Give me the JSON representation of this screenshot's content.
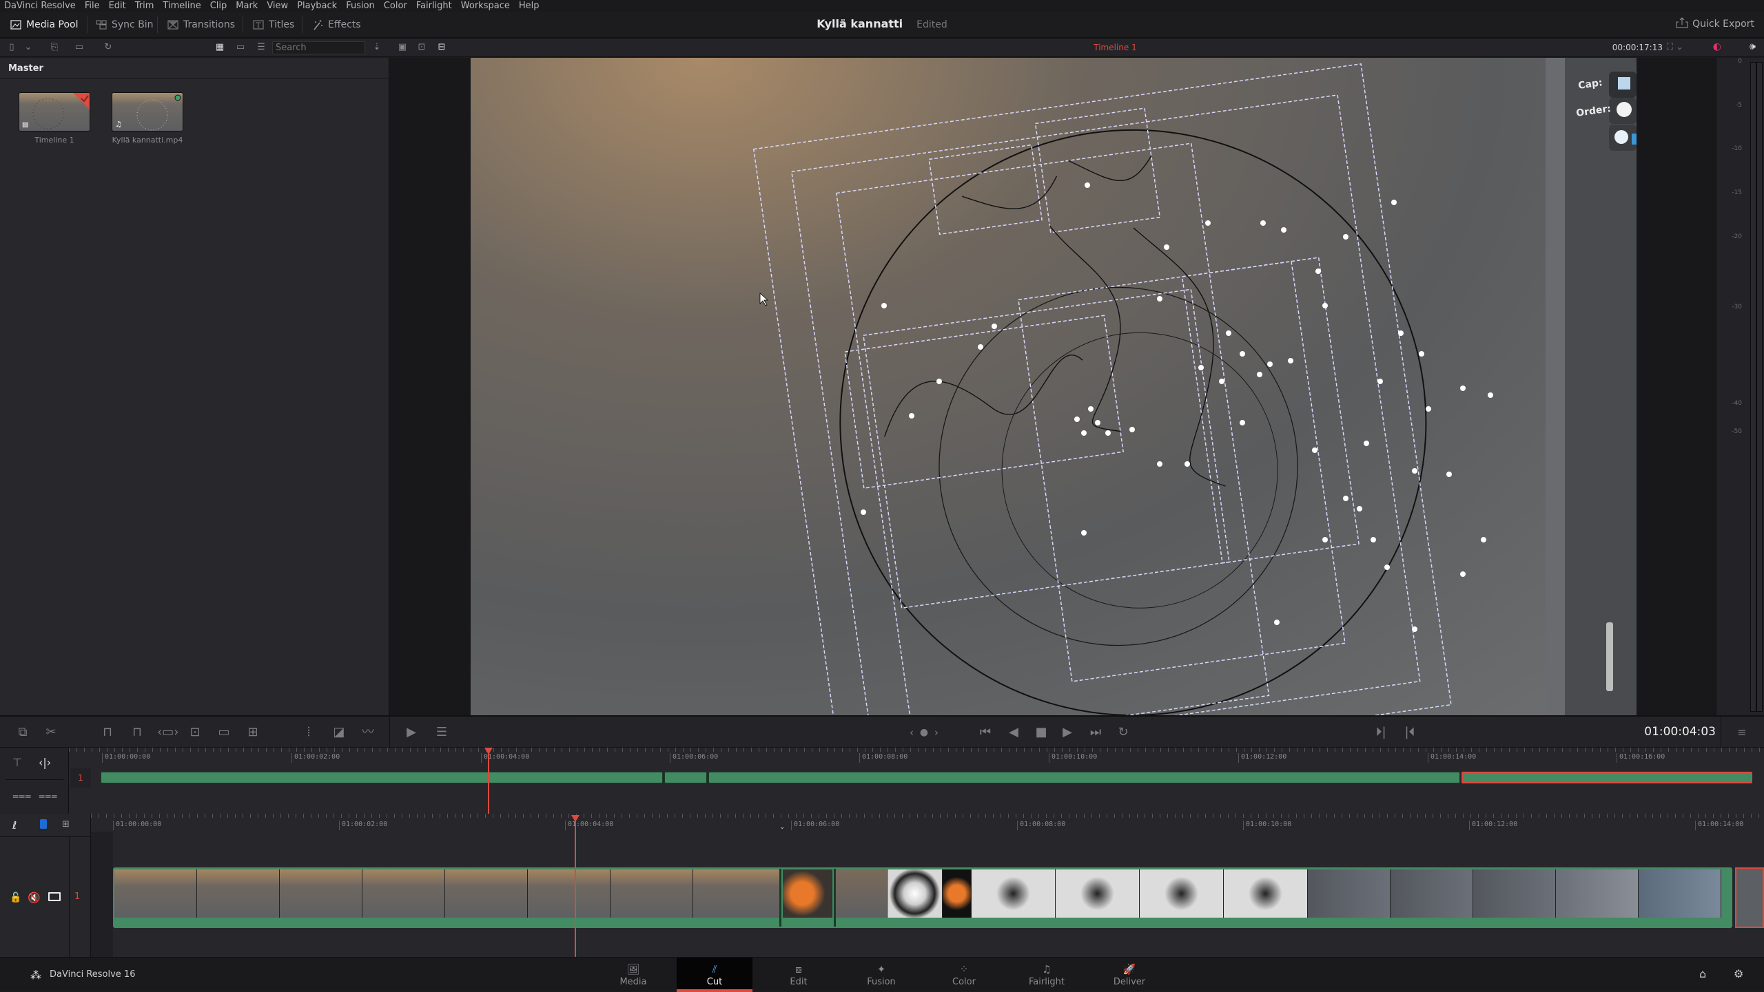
{
  "menu": [
    "DaVinci Resolve",
    "File",
    "Edit",
    "Trim",
    "Timeline",
    "Clip",
    "Mark",
    "View",
    "Playback",
    "Fusion",
    "Color",
    "Fairlight",
    "Workspace",
    "Help"
  ],
  "toolbar": {
    "media_pool": "Media Pool",
    "sync_bin": "Sync Bin",
    "transitions": "Transitions",
    "titles": "Titles",
    "effects": "Effects",
    "quick_export": "Quick Export"
  },
  "project": {
    "title": "Kyllä kannatti",
    "status": "Edited"
  },
  "media_pool": {
    "search_placeholder": "Search",
    "bin": "Master",
    "clips": [
      {
        "name": "Timeline 1",
        "type": "timeline",
        "badge": "selected-check"
      },
      {
        "name": "Kyllä kannatti.mp4",
        "type": "video-audio",
        "badge": "green-dot"
      }
    ]
  },
  "viewer": {
    "timeline_name": "Timeline 1",
    "duration": "00:00:17:13",
    "overlay_labels": [
      "Cap:",
      "Order:"
    ]
  },
  "audio_meter": {
    "ticks": [
      "0",
      "-5",
      "-10",
      "-15",
      "-20",
      "-30",
      "-40",
      "-50"
    ]
  },
  "transport": {
    "timecode": "01:00:04:03",
    "buttons": [
      "prev-marker",
      "marker",
      "next-marker",
      "go-to-start",
      "play-reverse",
      "stop",
      "play",
      "go-to-end",
      "loop",
      "next-edit",
      "previous-edit"
    ]
  },
  "upper_timeline": {
    "ruler_labels": [
      "01:00:00:00",
      "01:00:02:00",
      "01:00:04:00",
      "01:00:06:00",
      "01:00:08:00",
      "01:00:10:00",
      "01:00:12:00",
      "01:00:14:00",
      "01:00:16:00"
    ],
    "track_number": "1",
    "playhead": "01:00:04:03"
  },
  "lower_timeline": {
    "ruler_labels": [
      "01:00:00:00",
      "01:00:02:00",
      "01:00:04:00",
      "01:00:06:00",
      "01:00:08:00",
      "01:00:10:00",
      "01:00:12:00",
      "01:00:14:00"
    ],
    "track_number": "1",
    "track_audio": "muted"
  },
  "pages": [
    {
      "label": "Media",
      "icon": "media-icon",
      "active": false
    },
    {
      "label": "Cut",
      "icon": "cut-icon",
      "active": true
    },
    {
      "label": "Edit",
      "icon": "edit-icon",
      "active": false
    },
    {
      "label": "Fusion",
      "icon": "fusion-icon",
      "active": false
    },
    {
      "label": "Color",
      "icon": "color-icon",
      "active": false
    },
    {
      "label": "Fairlight",
      "icon": "fairlight-icon",
      "active": false
    },
    {
      "label": "Deliver",
      "icon": "deliver-icon",
      "active": false
    }
  ],
  "app_name": "DaVinci Resolve 16",
  "colors": {
    "accent_red": "#e04a3f",
    "clip_green": "#438b63",
    "panel": "#28282c"
  }
}
